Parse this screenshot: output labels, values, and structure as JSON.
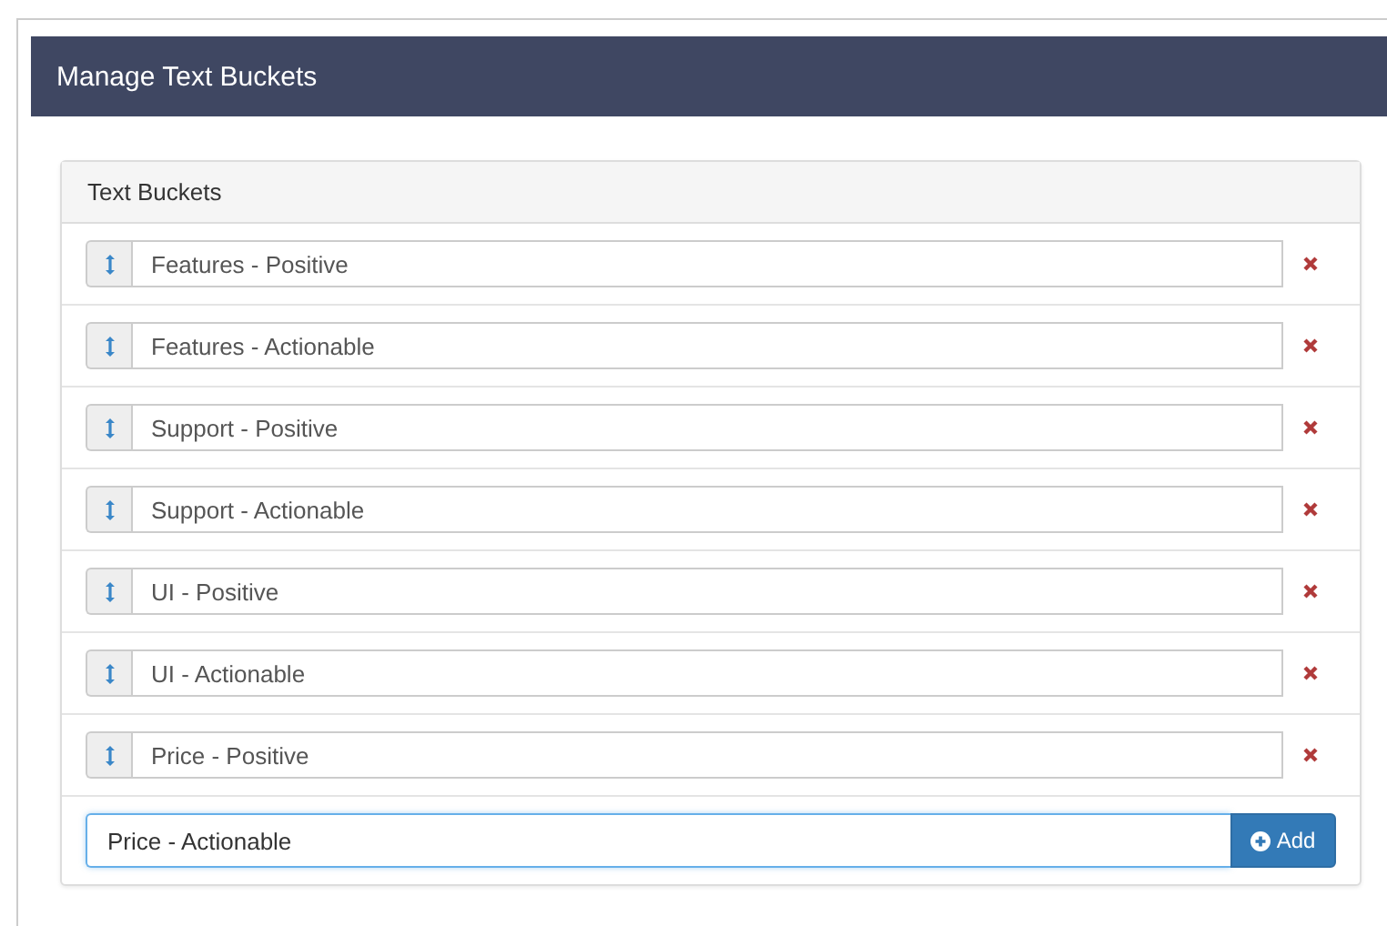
{
  "header": {
    "title": "Manage Text Buckets"
  },
  "panel": {
    "title": "Text Buckets",
    "buckets": [
      {
        "name": "Features - Positive"
      },
      {
        "name": "Features - Actionable"
      },
      {
        "name": "Support - Positive"
      },
      {
        "name": "Support - Actionable"
      },
      {
        "name": "UI - Positive"
      },
      {
        "name": "UI - Actionable"
      },
      {
        "name": "Price - Positive"
      }
    ],
    "new_bucket": {
      "value": "Price - Actionable",
      "button": "Add"
    }
  }
}
